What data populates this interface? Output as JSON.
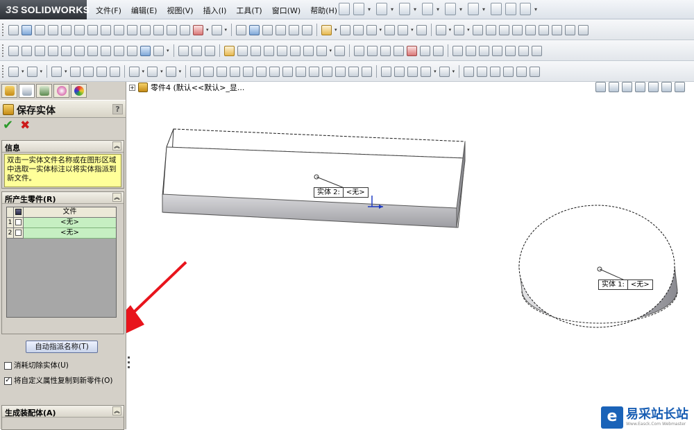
{
  "app": {
    "logo_prefix": "3S",
    "logo_name": "SOLIDWORKS"
  },
  "menu": [
    "文件(F)",
    "编辑(E)",
    "视图(V)",
    "插入(I)",
    "工具(T)",
    "窗口(W)",
    "帮助(H)"
  ],
  "tree": {
    "label": "零件4  (默认<<默认>_显..."
  },
  "property_manager": {
    "title": "保存实体",
    "help": "?",
    "ok": "✔",
    "cancel": "✖",
    "info": {
      "header": "信息",
      "message": "双击一实体文件名称或在图形区域中选取一实体标注以将实体指派到新文件。"
    },
    "parts": {
      "header": "所产生零件(R)",
      "column": "文件",
      "rows": [
        {
          "num": "1",
          "file": "<无>"
        },
        {
          "num": "2",
          "file": "<无>"
        }
      ]
    },
    "auto_assign": "自动指派名称(T)",
    "option_consume": "消耗切除实体(U)",
    "option_copy": "将自定义属性复制到新零件(O)",
    "assembly_header": "生成装配体(A)"
  },
  "callouts": {
    "body2": {
      "name": "实体 2:",
      "value": "<无>"
    },
    "body1": {
      "name": "实体 1:",
      "value": "<无>"
    }
  },
  "watermark": {
    "glyph": "e",
    "main": "易采站长站",
    "sub": "Www.Easck.Com Webmaster"
  },
  "colors": {
    "arrow": "#e8141c",
    "info_bg": "#ffff99",
    "row_bg": "#c6efc2"
  }
}
